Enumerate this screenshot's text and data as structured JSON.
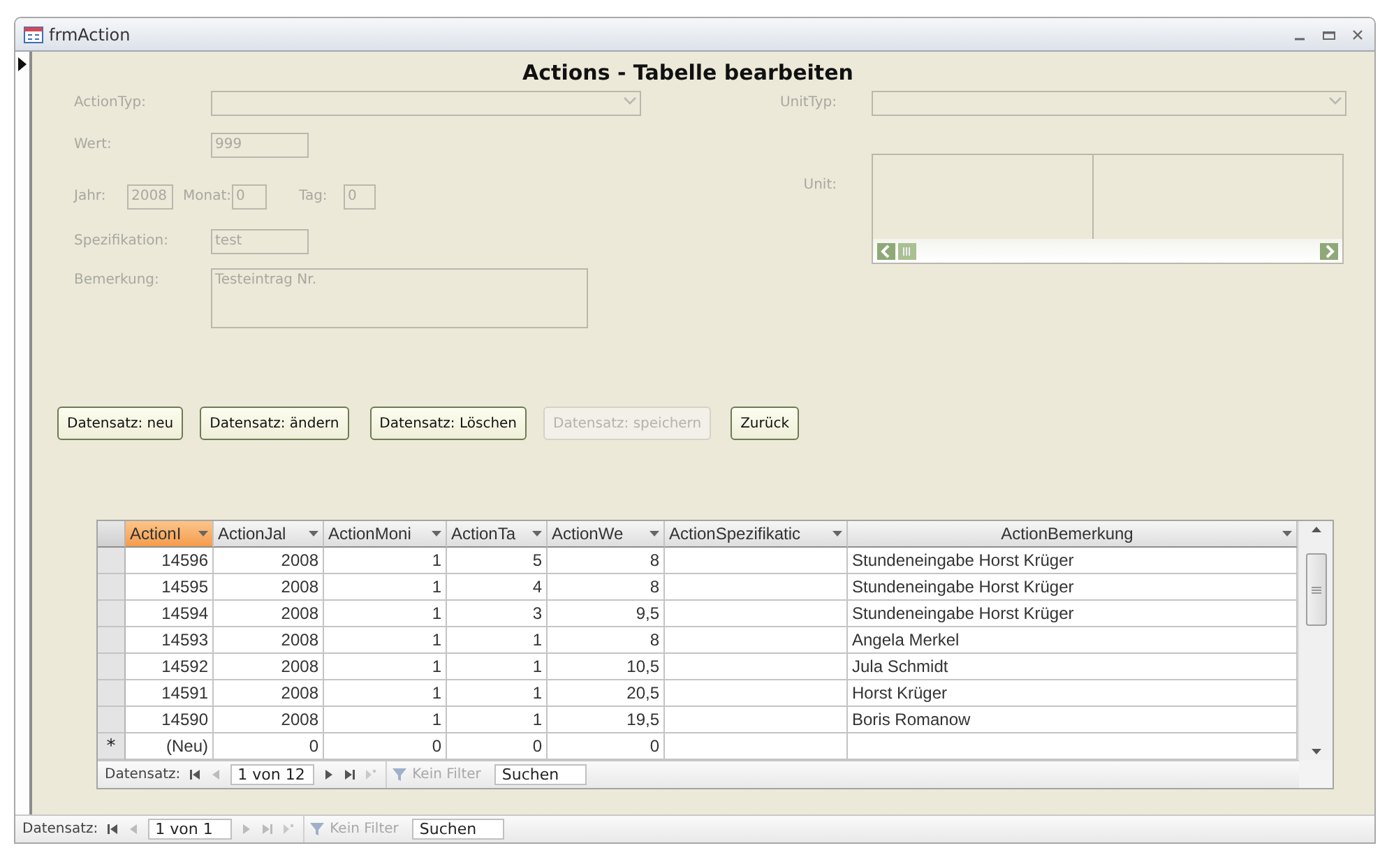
{
  "window": {
    "title": "frmAction"
  },
  "form": {
    "heading": "Actions - Tabelle bearbeiten",
    "left_fields": [
      {
        "kind": "combo",
        "label": "ActionTyp:",
        "disabled": true
      },
      {
        "kind": "text",
        "label": "Wert:",
        "value": "999",
        "disabled": true
      },
      {
        "kind": "date",
        "disabled": true,
        "parts": [
          {
            "label": "Jahr:",
            "value": "2008"
          },
          {
            "label": "Monat:",
            "value": "0"
          },
          {
            "label": "Tag:",
            "value": "0"
          }
        ]
      },
      {
        "kind": "text",
        "label": "Spezifikation:",
        "value": "test",
        "disabled": true
      },
      {
        "kind": "memo",
        "label": "Bemerkung:",
        "value": "Testeintrag Nr.",
        "disabled": true
      }
    ],
    "right_fields": [
      {
        "kind": "combo",
        "label": "UnitTyp:",
        "disabled": true
      },
      {
        "kind": "list",
        "label": "Unit:",
        "disabled": true
      }
    ],
    "buttons": [
      {
        "label": "Datensatz: neu",
        "disabled": false
      },
      {
        "label": "Datensatz: ändern",
        "disabled": false
      },
      {
        "label": "Datensatz: Löschen",
        "disabled": false
      },
      {
        "label": "Datensatz: speichern",
        "disabled": true
      },
      {
        "label": "Zurück",
        "disabled": false
      }
    ]
  },
  "datasheet": {
    "columns": [
      {
        "label": "ActionI",
        "selected": true
      },
      {
        "label": "ActionJal",
        "selected": false
      },
      {
        "label": "ActionMoni",
        "selected": false
      },
      {
        "label": "ActionTa",
        "selected": false
      },
      {
        "label": "ActionWe",
        "selected": false
      },
      {
        "label": "ActionSpezifikatic",
        "selected": false
      },
      {
        "label": "ActionBemerkung",
        "selected": false
      }
    ],
    "rows": [
      {
        "cells": [
          "14596",
          "2008",
          "1",
          "5",
          "8"
        ],
        "remark": "Stundeneingabe Horst Krüger"
      },
      {
        "cells": [
          "14595",
          "2008",
          "1",
          "4",
          "8"
        ],
        "remark": "Stundeneingabe Horst Krüger"
      },
      {
        "cells": [
          "14594",
          "2008",
          "1",
          "3",
          "9,5"
        ],
        "remark": "Stundeneingabe Horst Krüger"
      },
      {
        "cells": [
          "14593",
          "2008",
          "1",
          "1",
          "8"
        ],
        "remark": "Angela Merkel"
      },
      {
        "cells": [
          "14592",
          "2008",
          "1",
          "1",
          "10,5"
        ],
        "remark": "Jula Schmidt"
      },
      {
        "cells": [
          "14591",
          "2008",
          "1",
          "1",
          "20,5"
        ],
        "remark": "Horst Krüger"
      },
      {
        "cells": [
          "14590",
          "2008",
          "1",
          "1",
          "19,5"
        ],
        "remark": "Boris Romanow"
      }
    ],
    "new_row": {
      "marker": "*",
      "cells": [
        "(Neu)",
        "0",
        "0",
        "0",
        "0"
      ]
    },
    "navigation": {
      "label": "Datensatz:",
      "position": "1 von 12",
      "filter": "Kein Filter",
      "search": "Suchen"
    }
  },
  "status_navigation": {
    "label": "Datensatz:",
    "position": "1 von 1",
    "filter": "Kein Filter",
    "search": "Suchen"
  }
}
